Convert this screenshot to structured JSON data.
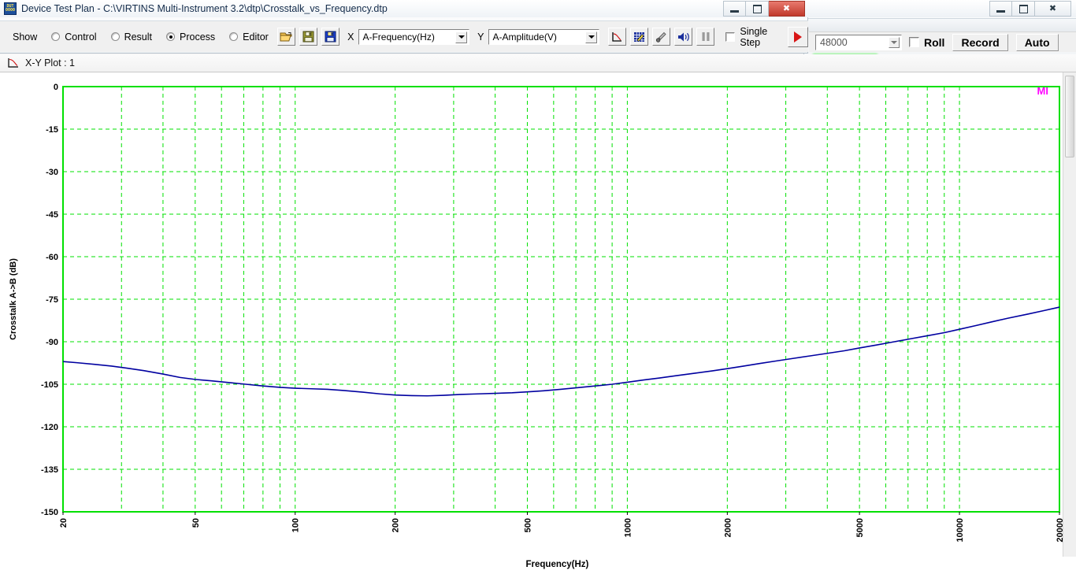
{
  "window": {
    "title": "Device Test Plan - C:\\VIRTINS Multi-Instrument 3.2\\dtp\\Crosstalk_vs_Frequency.dtp",
    "app_icon_top": "DUT",
    "app_icon_bottom": "0000",
    "minimize": "–",
    "maximize": "❐",
    "close": "✕"
  },
  "toolbar": {
    "show_label": "Show",
    "radios": [
      {
        "label": "Control",
        "selected": false
      },
      {
        "label": "Result",
        "selected": false
      },
      {
        "label": "Process",
        "selected": true
      },
      {
        "label": "Editor",
        "selected": false
      }
    ],
    "open_button": "open-file",
    "save_button": "save-file",
    "saveas_button": "save-as-file",
    "x_label": "X",
    "x_value": "A-Frequency(Hz)",
    "y_label": "Y",
    "y_value": "A-Amplitude(V)",
    "plot_button": "xy-plot",
    "table_button": "data-table",
    "probe_button": "probe",
    "sound_button": "sound",
    "pause_button": "pause",
    "single_step_label": "Single Step",
    "single_step_checked": false,
    "run_button": "run"
  },
  "secondary_toolbar": {
    "sample_rate": "48000",
    "roll_label": "Roll",
    "roll_checked": false,
    "record_label": "Record",
    "auto_label": "Auto",
    "minimize": "–",
    "restore": "❐",
    "close": "✕"
  },
  "panel": {
    "title": "X-Y Plot : 1"
  },
  "watermark": "MI",
  "colors": {
    "grid": "#00e000",
    "axis": "#00e000",
    "curve": "#0000a0",
    "watermark": "#ff00ff",
    "plot_background": "#ffffff",
    "title_text": "#132b4a"
  },
  "chart_data": {
    "type": "line",
    "title": "X-Y Plot : 1",
    "xlabel": "Frequency(Hz)",
    "ylabel": "Crosstalk A->B (dB)",
    "xscale": "log",
    "xlim": [
      20,
      20000
    ],
    "ylim": [
      -150,
      0
    ],
    "grid": true,
    "legend": null,
    "xticks": [
      20,
      50,
      100,
      200,
      500,
      1000,
      2000,
      5000,
      10000,
      20000
    ],
    "xtick_labels": [
      "20",
      "50",
      "100",
      "200",
      "500",
      "1000",
      "2000",
      "5000",
      "10000",
      "20000"
    ],
    "yticks": [
      0,
      -15,
      -30,
      -45,
      -60,
      -75,
      -90,
      -105,
      -120,
      -135,
      -150
    ],
    "ytick_labels": [
      "0",
      "-15",
      "-30",
      "-45",
      "-60",
      "-75",
      "-90",
      "-105",
      "-120",
      "-135",
      "-150"
    ],
    "series": [
      {
        "name": "Crosstalk A->B",
        "color": "#0000a0",
        "x": [
          20,
          22,
          25,
          28,
          31,
          35,
          40,
          45,
          50,
          56,
          63,
          71,
          80,
          90,
          100,
          112,
          125,
          140,
          160,
          180,
          200,
          224,
          250,
          280,
          315,
          355,
          400,
          450,
          500,
          560,
          630,
          710,
          800,
          900,
          1000,
          1120,
          1250,
          1400,
          1600,
          1800,
          2000,
          2240,
          2500,
          2800,
          3150,
          3550,
          4000,
          4500,
          5000,
          5600,
          6300,
          7100,
          8000,
          9000,
          10000,
          11200,
          12500,
          14000,
          16000,
          18000,
          20000
        ],
        "y": [
          -97.0,
          -97.4,
          -98.0,
          -98.6,
          -99.3,
          -100.2,
          -101.4,
          -102.6,
          -103.3,
          -103.8,
          -104.4,
          -105.0,
          -105.6,
          -106.1,
          -106.4,
          -106.6,
          -106.8,
          -107.2,
          -107.8,
          -108.4,
          -108.8,
          -109.0,
          -109.1,
          -108.9,
          -108.6,
          -108.4,
          -108.2,
          -108.0,
          -107.7,
          -107.3,
          -106.8,
          -106.2,
          -105.6,
          -105.0,
          -104.3,
          -103.5,
          -102.8,
          -102.0,
          -101.1,
          -100.3,
          -99.5,
          -98.6,
          -97.7,
          -96.8,
          -95.9,
          -95.0,
          -94.1,
          -93.2,
          -92.2,
          -91.2,
          -90.1,
          -89.0,
          -87.9,
          -86.8,
          -85.6,
          -84.3,
          -83.0,
          -81.7,
          -80.3,
          -79.0,
          -77.8
        ]
      }
    ]
  }
}
